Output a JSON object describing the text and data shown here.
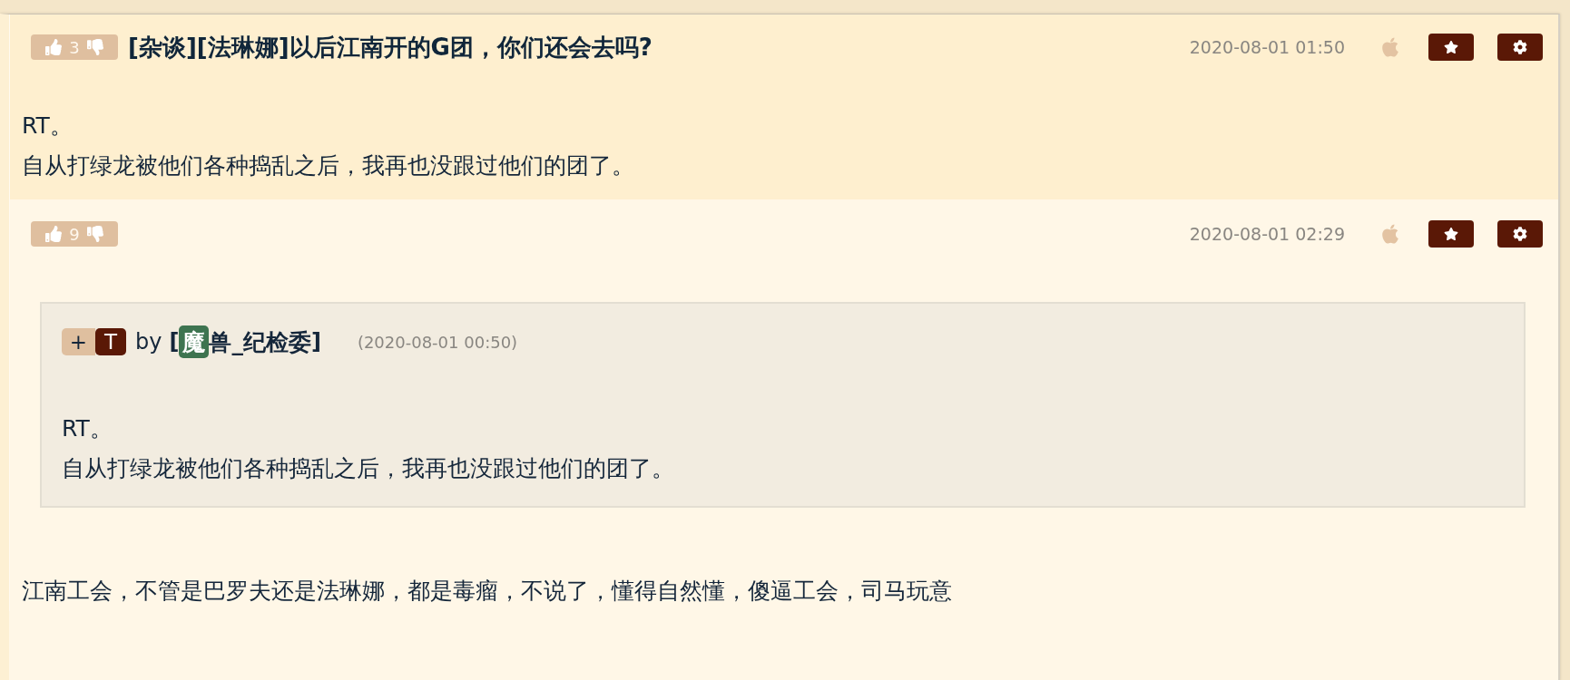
{
  "posts": [
    {
      "kind": "topic",
      "votes": "3",
      "title": "[杂谈][法琳娜]以后江南开的G团，你们还会去吗?",
      "time": "2020-08-01 01:50",
      "paragraphs": [
        "RT。",
        "自从打绿龙被他们各种捣乱之后，我再也没跟过他们的团了。"
      ]
    },
    {
      "kind": "reply",
      "votes": "9",
      "time": "2020-08-01 02:29",
      "quote": {
        "tags": [
          {
            "text": "+",
            "kind": "light"
          },
          {
            "text": "T",
            "kind": "dark"
          }
        ],
        "by": "by",
        "author": {
          "open": "[",
          "badge": "魔",
          "name": "兽_纪检委",
          "close": "]"
        },
        "time": "(2020-08-01 00:50)",
        "paragraphs": [
          "RT。",
          "自从打绿龙被他们各种捣乱之后，我再也没跟过他们的团了。"
        ]
      },
      "paragraphs": [
        "江南工会，不管是巴罗夫还是法琳娜，都是毒瘤，不说了，懂得自然懂，傻逼工会，司马玩意"
      ]
    }
  ]
}
